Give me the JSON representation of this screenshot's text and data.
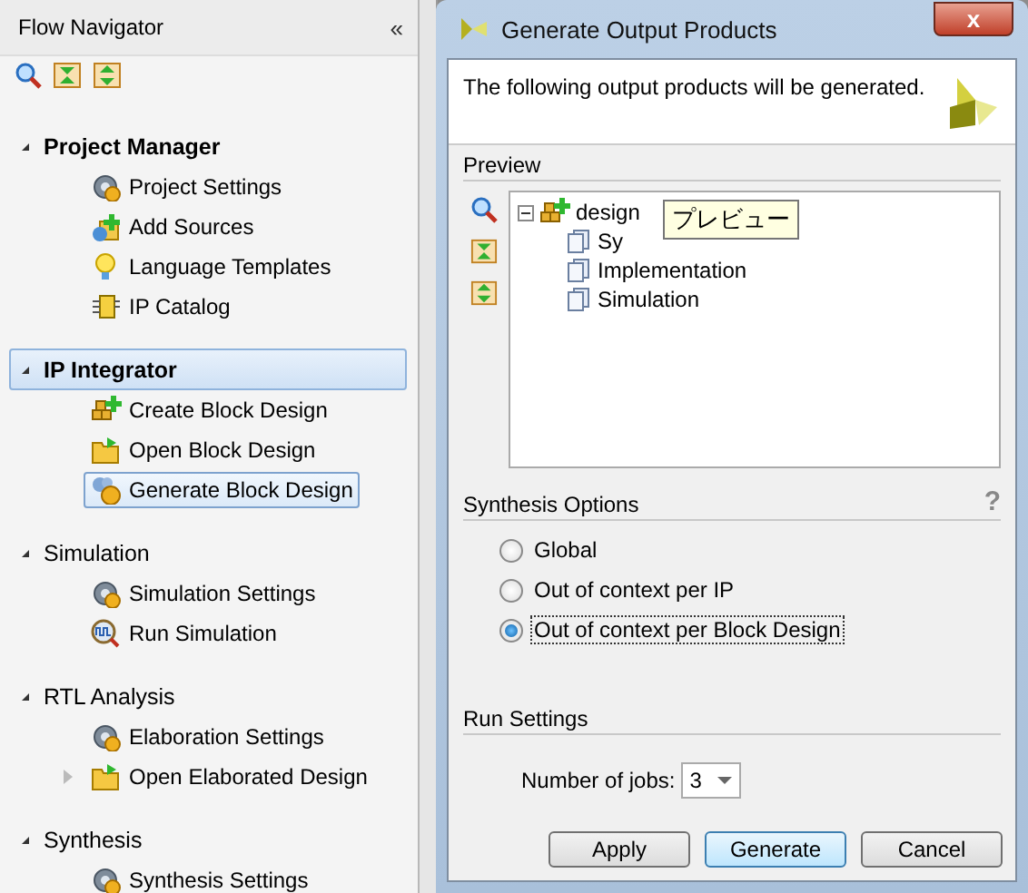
{
  "flow_navigator": {
    "title": "Flow Navigator",
    "collapse_button": "«",
    "sections": [
      {
        "title": "Project Manager",
        "emphasized": true,
        "selected": false,
        "expanded": true,
        "items": [
          {
            "label": "Project Settings",
            "kind": "gear",
            "selected": false
          },
          {
            "label": "Add Sources",
            "kind": "add",
            "selected": false
          },
          {
            "label": "Language Templates",
            "kind": "bulb",
            "selected": false
          },
          {
            "label": "IP Catalog",
            "kind": "chip",
            "selected": false
          }
        ]
      },
      {
        "title": "IP Integrator",
        "emphasized": true,
        "selected": true,
        "expanded": true,
        "items": [
          {
            "label": "Create Block Design",
            "kind": "blocks",
            "selected": false
          },
          {
            "label": "Open Block Design",
            "kind": "folder",
            "selected": false
          },
          {
            "label": "Generate Block Design",
            "kind": "generate",
            "selected": true
          }
        ]
      },
      {
        "title": "Simulation",
        "emphasized": false,
        "selected": false,
        "expanded": true,
        "items": [
          {
            "label": "Simulation Settings",
            "kind": "gear",
            "selected": false
          },
          {
            "label": "Run Simulation",
            "kind": "wave",
            "selected": false
          }
        ]
      },
      {
        "title": "RTL Analysis",
        "emphasized": false,
        "selected": false,
        "expanded": true,
        "items": [
          {
            "label": "Elaboration Settings",
            "kind": "gear",
            "selected": false
          },
          {
            "label": "Open Elaborated Design",
            "kind": "folder",
            "selected": false,
            "expanded": false
          }
        ]
      },
      {
        "title": "Synthesis",
        "emphasized": false,
        "selected": false,
        "expanded": true,
        "items": [
          {
            "label": "Synthesis Settings",
            "kind": "gear",
            "selected": false
          }
        ]
      }
    ]
  },
  "dialog": {
    "title": "Generate Output Products",
    "close_button": "x",
    "message": "The following output products will be generated.",
    "preview": {
      "label": "Preview",
      "tree": {
        "label": "design",
        "expanded": true,
        "children": [
          {
            "label": "Sy"
          },
          {
            "label": "Implementation"
          },
          {
            "label": "Simulation"
          }
        ]
      },
      "tooltip": "プレビュー"
    },
    "synthesis_options": {
      "label": "Synthesis Options",
      "help": "?",
      "options": [
        {
          "label": "Global",
          "selected": false
        },
        {
          "label": "Out of context per IP",
          "selected": false
        },
        {
          "label": "Out of context per Block Design",
          "selected": true
        }
      ]
    },
    "run_settings": {
      "label": "Run Settings",
      "jobs_label": "Number of jobs:",
      "jobs_value": "3"
    },
    "buttons": [
      {
        "label": "Apply",
        "default": false
      },
      {
        "label": "Generate",
        "default": true
      },
      {
        "label": "Cancel",
        "default": false
      }
    ]
  }
}
